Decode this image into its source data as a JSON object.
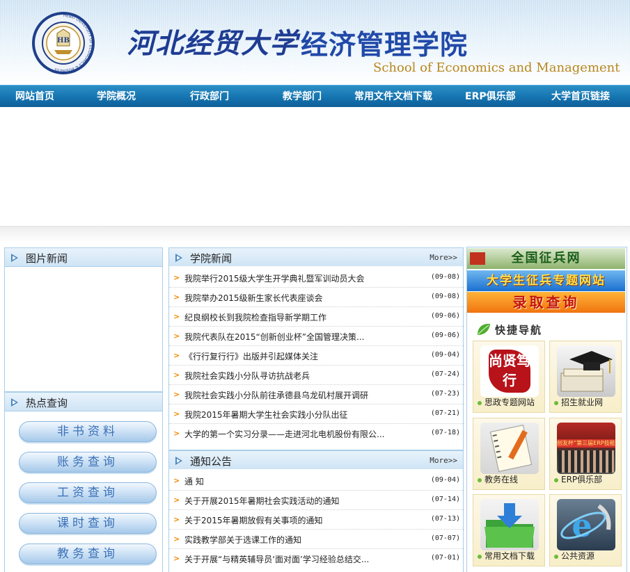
{
  "header": {
    "university_title": "河北经贸大学",
    "college_title": "经济管理学院",
    "english_title": "School of Economics and Management",
    "logo_text": "HEBEI UNIVERSITY OF ECONOMICS & BUSINESS"
  },
  "nav": {
    "items": [
      "网站首页",
      "学院概况",
      "行政部门",
      "教学部门",
      "常用文件文档下载",
      "ERP俱乐部",
      "大学首页链接"
    ]
  },
  "photo_news": {
    "title": "图片新闻"
  },
  "hot_query": {
    "title": "热点查询",
    "buttons": [
      "非书资料",
      "账务查询",
      "工资查询",
      "课时查询",
      "教务查询"
    ]
  },
  "college_news": {
    "title": "学院新闻",
    "more": "More>>",
    "items": [
      {
        "title": "我院举行2015级大学生开学典礼暨军训动员大会",
        "date": "(09-08)"
      },
      {
        "title": "我院举办2015级新生家长代表座谈会",
        "date": "(09-08)"
      },
      {
        "title": "纪良纲校长到我院检查指导新学期工作",
        "date": "(09-06)"
      },
      {
        "title": "我院代表队在2015“创新创业杯”全国管理决策...",
        "date": "(09-06)"
      },
      {
        "title": "《行行复行行》出版并引起媒体关注",
        "date": "(09-04)"
      },
      {
        "title": "我院社会实践小分队寻访抗战老兵",
        "date": "(07-24)"
      },
      {
        "title": "我院社会实践小分队前往承德县乌龙矶村展开调研",
        "date": "(07-23)"
      },
      {
        "title": "我院2015年暑期大学生社会实践小分队出征",
        "date": "(07-21)"
      },
      {
        "title": "大学的第一个实习分录——走进河北电机股份有限公...",
        "date": "(07-18)"
      }
    ]
  },
  "notices": {
    "title": "通知公告",
    "more": "More>>",
    "items": [
      {
        "title": "通 知",
        "date": "(09-04)"
      },
      {
        "title": "关于开展2015年暑期社会实践活动的通知",
        "date": "(07-14)"
      },
      {
        "title": "关于2015年暑期放假有关事项的通知",
        "date": "(07-13)"
      },
      {
        "title": "实践教学部关于选课工作的通知",
        "date": "(07-07)"
      },
      {
        "title": "关于开展“与精英辅导员‘面对面’学习经验总结交...",
        "date": "(07-01)"
      }
    ]
  },
  "banners": [
    "全国征兵网",
    "大学生征兵专题网站",
    "录取查询"
  ],
  "quick_nav": {
    "title": "快捷导航",
    "seal_text": "尚贤笃行",
    "erp_photo_caption": "创友杯”第三届ERP技能",
    "tiles": [
      {
        "label": "思政专题网站",
        "icon": "seal-icon"
      },
      {
        "label": "招生就业网",
        "icon": "graduation-cap-icon"
      },
      {
        "label": "教务在线",
        "icon": "notebook-icon"
      },
      {
        "label": "ERP俱乐部",
        "icon": "group-photo-icon"
      },
      {
        "label": "常用文档下载",
        "icon": "folder-download-icon"
      },
      {
        "label": "公共资源",
        "icon": "internet-explorer-icon"
      }
    ]
  },
  "colors": {
    "nav_blue": "#1677b3",
    "date_orange": "#f08a00",
    "title_blue": "#1e3c93",
    "english_gold": "#b8861d"
  }
}
